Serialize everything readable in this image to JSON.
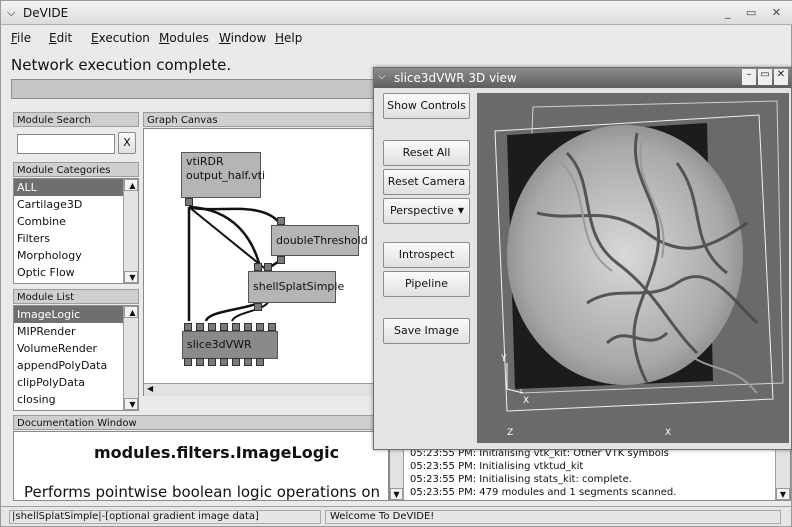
{
  "window": {
    "title": "DeVIDE"
  },
  "menu": [
    "File",
    "Edit",
    "Execution",
    "Modules",
    "Window",
    "Help"
  ],
  "status_message": "Network execution complete.",
  "module_search": {
    "header": "Module Search",
    "clear_label": "X",
    "value": ""
  },
  "module_categories": {
    "header": "Module Categories",
    "items": [
      "ALL",
      "Cartilage3D",
      "Combine",
      "Filters",
      "Morphology",
      "Optic Flow"
    ]
  },
  "module_list": {
    "header": "Module List",
    "items": [
      "ImageLogic",
      "MIPRender",
      "VolumeRender",
      "appendPolyData",
      "clipPolyData",
      "closing"
    ]
  },
  "graph_canvas": {
    "header": "Graph Canvas",
    "nodes": [
      {
        "line1": "vtiRDR",
        "line2": "output_half.vti"
      },
      {
        "line1": "doubleThreshold",
        "line2": ""
      },
      {
        "line1": "shellSplatSimple",
        "line2": ""
      },
      {
        "line1": "slice3dVWR",
        "line2": ""
      }
    ]
  },
  "documentation": {
    "header": "Documentation Window",
    "title": "modules.filters.ImageLogic",
    "body": "Performs pointwise boolean logic operations on"
  },
  "log": {
    "lines": [
      "05:23:55 PM: Initialising vtk_kit: Other VTK symbols",
      "05:23:55 PM: Initialising vtktud_kit",
      "05:23:55 PM: Initialising stats_kit: complete.",
      "05:23:55 PM: 479 modules and 1 segments scanned."
    ]
  },
  "statusbar": {
    "left": "|shellSplatSimple|-[optional gradient image data]",
    "right": "Welcome To DeVIDE!"
  },
  "viewer": {
    "title": "slice3dVWR 3D view",
    "buttons": {
      "show_controls": "Show Controls",
      "reset_all": "Reset All",
      "reset_camera": "Reset Camera",
      "perspective": "Perspective",
      "introspect": "Introspect",
      "pipeline": "Pipeline",
      "save_image": "Save Image"
    },
    "axis_labels": {
      "y": "Y",
      "x": "X",
      "z": "Z"
    }
  }
}
